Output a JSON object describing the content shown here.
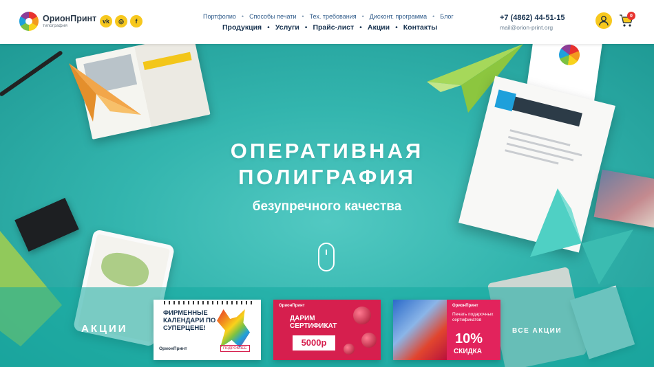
{
  "header": {
    "logo": {
      "name": "ОрионПринт",
      "subtitle": "типография"
    },
    "social": [
      {
        "icon": "vk-icon",
        "glyph": "vk"
      },
      {
        "icon": "instagram-icon",
        "glyph": "◎"
      },
      {
        "icon": "facebook-icon",
        "glyph": "f"
      }
    ],
    "nav_top": [
      "Портфолио",
      "Способы печати",
      "Тех. требования",
      "Дисконт. программа",
      "Блог"
    ],
    "nav_main": [
      "Продукция",
      "Услуги",
      "Прайс-лист",
      "Акции",
      "Контакты"
    ],
    "phone": "+7 (4862) 44-51-15",
    "email": "mail@orion-print.org",
    "cart_count": "0",
    "colors": {
      "accent_yellow": "#f7c81e",
      "brand_red": "#e8322e",
      "nav_blue": "#2f5b8a"
    }
  },
  "hero": {
    "title_line1": "ОПЕРАТИВНАЯ",
    "title_line2": "ПОЛИГРАФИЯ",
    "subtitle": "безупречного качества",
    "background": "#33b5ae"
  },
  "promo": {
    "label": "АКЦИИ",
    "all_link": "ВСЕ АКЦИИ",
    "cards": [
      {
        "title": "ФИРМЕННЫЕ КАЛЕНДАРИ ПО СУПЕРЦЕНЕ!",
        "logo": "ОрионПринт",
        "button": "ПОДРОБНЕЕ"
      },
      {
        "logo": "ОрионПринт",
        "title_line1": "ДАРИМ",
        "title_line2": "СЕРТИФИКАТ",
        "price": "5000р"
      },
      {
        "logo": "ОрионПринт",
        "text": "Печать подарочных сертификатов",
        "percent": "10%",
        "label": "СКИДКА"
      }
    ]
  }
}
